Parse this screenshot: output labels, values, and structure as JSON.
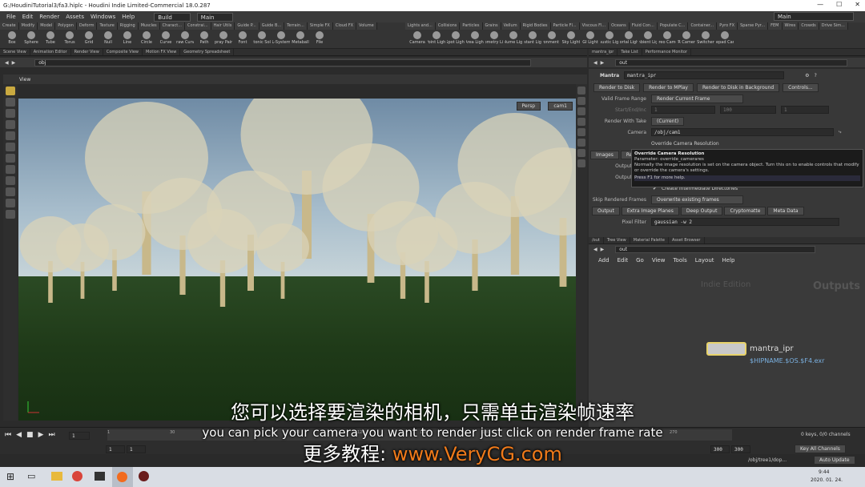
{
  "window": {
    "title": "G:/HoudiniTutorial3/fa3.hiplc - Houdini Indie Limited-Commercial 18.0.287"
  },
  "menu": {
    "items": [
      "File",
      "Edit",
      "Render",
      "Assets",
      "Windows",
      "Help"
    ],
    "build": "Build",
    "main": "Main",
    "main_right": "Main"
  },
  "shelf": {
    "tabs_left": [
      "Create",
      "Modify",
      "Model",
      "Polygon",
      "Deform",
      "Texture",
      "Rigging",
      "Muscles",
      "Charact...",
      "Constrai...",
      "Hair Utils",
      "Guide P...",
      "Guide B...",
      "Terrain...",
      "Simple FX",
      "Cloud FX",
      "Volume"
    ],
    "tabs_right": [
      "Lights and...",
      "Collisions",
      "Particles",
      "Grains",
      "Vellum",
      "Rigid Bodies",
      "Particle Fl...",
      "Viscous Fl...",
      "Oceans",
      "Fluid Con...",
      "Populate C...",
      "Container...",
      "Pyro FX",
      "Sparse Pyr...",
      "FEM",
      "Wires",
      "Crowds",
      "Drive Sim..."
    ],
    "tools_left": [
      "Box",
      "Sphere",
      "Tube",
      "Torus",
      "Grid",
      "Null",
      "Line",
      "Circle",
      "Curve",
      "Draw Curve",
      "Path",
      "Spray Paint",
      "Font",
      "Platonic Solids",
      "L-System",
      "Metaball",
      "File"
    ],
    "tools_right": [
      "Camera",
      "Point Light",
      "Spot Light",
      "Area Light",
      "Geometry Light",
      "Volume Light",
      "Distant Light",
      "Environment Light",
      "Sky Light",
      "GI Light",
      "Caustic Light",
      "Portal Light",
      "Ambient Light",
      "Stereo Camera",
      "VR Camera",
      "Switcher",
      "Gamepad Camera"
    ]
  },
  "left_tabs": [
    "Scene View",
    "Animation Editor",
    "Render View",
    "Composite View",
    "Motion FX View",
    "Geometry Spreadsheet"
  ],
  "left_path": "obj",
  "viewport": {
    "label": "View",
    "persp": "Persp",
    "cam": "cam1"
  },
  "right_tabs": [
    "mantra_ipr",
    "Take List",
    "Performance Monitor"
  ],
  "right_path": "out",
  "param": {
    "node_type": "Mantra",
    "node_name": "mantra_ipr",
    "buttons": [
      "Render to Disk",
      "Render to MPlay",
      "Render to Disk in Background",
      "Controls..."
    ],
    "valid_frame_range_label": "Valid Frame Range",
    "valid_frame_range_value": "Render Current Frame",
    "start_end_inc_label": "Start/End/Inc",
    "start_val": "1",
    "end_val": "100",
    "inc_val": "1",
    "render_with_take_label": "Render With Take",
    "render_with_take_value": "(Current)",
    "camera_label": "Camera",
    "camera_value": "/obj/cam1",
    "override_res_label": "Override Camera Resolution",
    "tabs": [
      "Images",
      "Rendering"
    ],
    "output_label": "Output",
    "output_label2": "Output",
    "create_dirs_label": "Create Intermediate Directories",
    "skip_label": "Skip Rendered Frames",
    "skip_value": "Overwrite existing frames",
    "subtabs": [
      "Output",
      "Extra Image Planes",
      "Deep Output",
      "Cryptomatte",
      "Meta Data"
    ],
    "pixel_filter_label": "Pixel Filter",
    "pixel_filter_value": "gaussian -w 2"
  },
  "tooltip": {
    "title": "Override Camera Resolution",
    "param": "Parameter: override_camerares",
    "desc": "Normally the image resolution is set on the camera object. Turn this on to enable controls that modify or override the camera's settings.",
    "help": "Press F1 for more help."
  },
  "network": {
    "tabs": [
      "/out",
      "Tree View",
      "Material Palette",
      "Asset Browser"
    ],
    "path": "out",
    "menu": [
      "Add",
      "Edit",
      "Go",
      "View",
      "Tools",
      "Layout",
      "Help"
    ],
    "watermark": "Indie Edition",
    "context": "Outputs",
    "node_name": "mantra_ipr",
    "node_sub": "$HIPNAME.$OS.$F4.exr"
  },
  "timeline": {
    "frame": "1",
    "ticks": [
      "1",
      "30",
      "60",
      "90",
      "120",
      "150",
      "180",
      "210",
      "240",
      "270"
    ],
    "start": "1",
    "start2": "1",
    "end": "300",
    "end2": "300",
    "keys": "0 keys, 0/0 channels",
    "key_all": "Key All Channels",
    "auto_update": "Auto Update",
    "path": "/obj/tree1/dop..."
  },
  "subtitles": {
    "cn": "您可以选择要渲染的相机，只需单击渲染帧速率",
    "en": "you can pick your camera you want to render just click on render frame rate",
    "promo_prefix": "更多教程: ",
    "promo_url": "www.VeryCG.com"
  },
  "taskbar": {
    "time": "9:44",
    "date": "2020. 01. 24."
  },
  "colors": {
    "accent": "#f07a1a",
    "node_outline": "#e8d36a",
    "node_label": "#7ab0e0"
  }
}
